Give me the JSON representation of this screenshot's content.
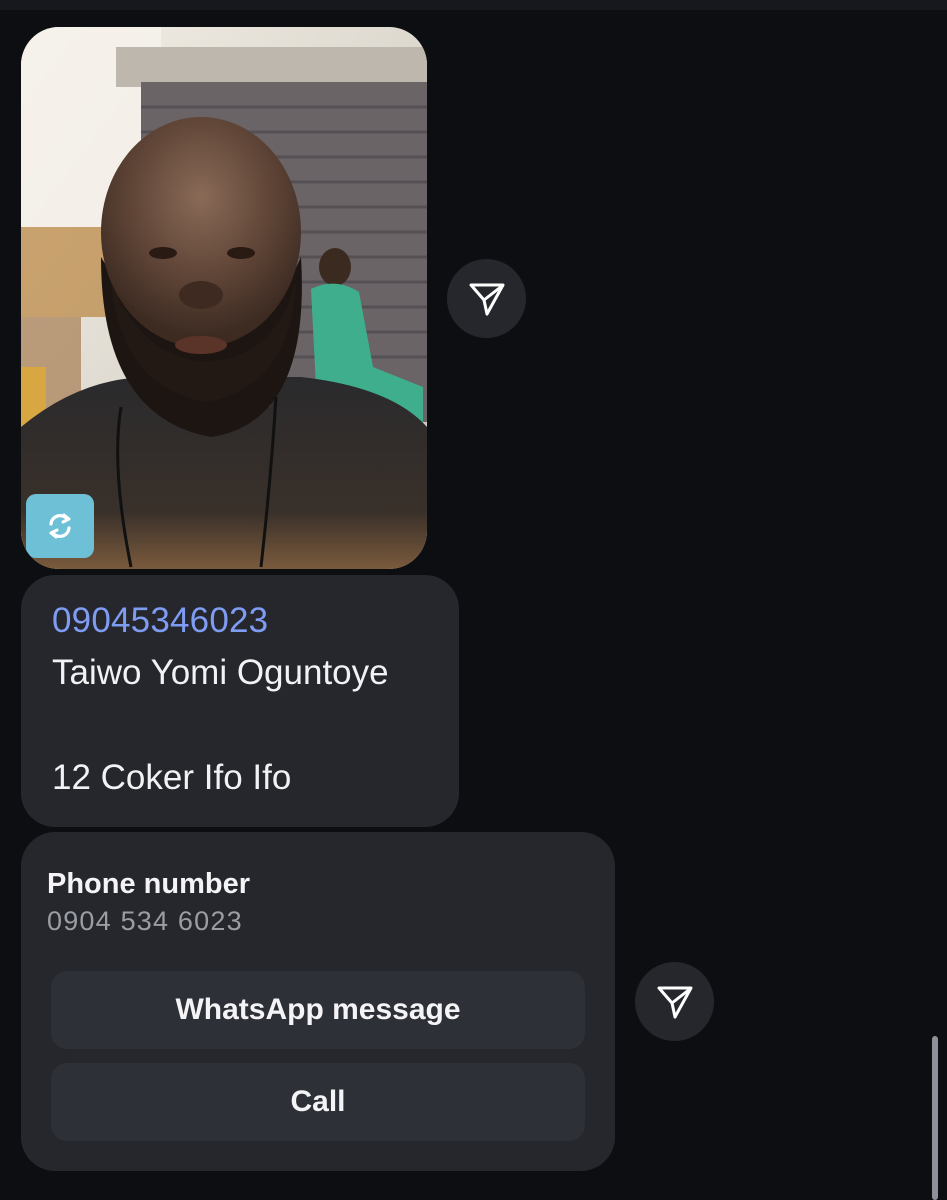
{
  "photo_message": {
    "media_badge_icon": "sync-icon",
    "forward_icon": "send-icon"
  },
  "text_message": {
    "phone_link": "09045346023",
    "name_line": "Taiwo Yomi Oguntoye",
    "address_line": "12 Coker Ifo Ifo"
  },
  "contact_card": {
    "title": "Phone number",
    "number": "0904 534 6023",
    "whatsapp_label": "WhatsApp message",
    "call_label": "Call",
    "forward_icon": "send-icon"
  },
  "colors": {
    "background": "#0c0e12",
    "bubble": "#25272d",
    "link": "#7f9cf3",
    "badge": "#6ec0d6"
  }
}
